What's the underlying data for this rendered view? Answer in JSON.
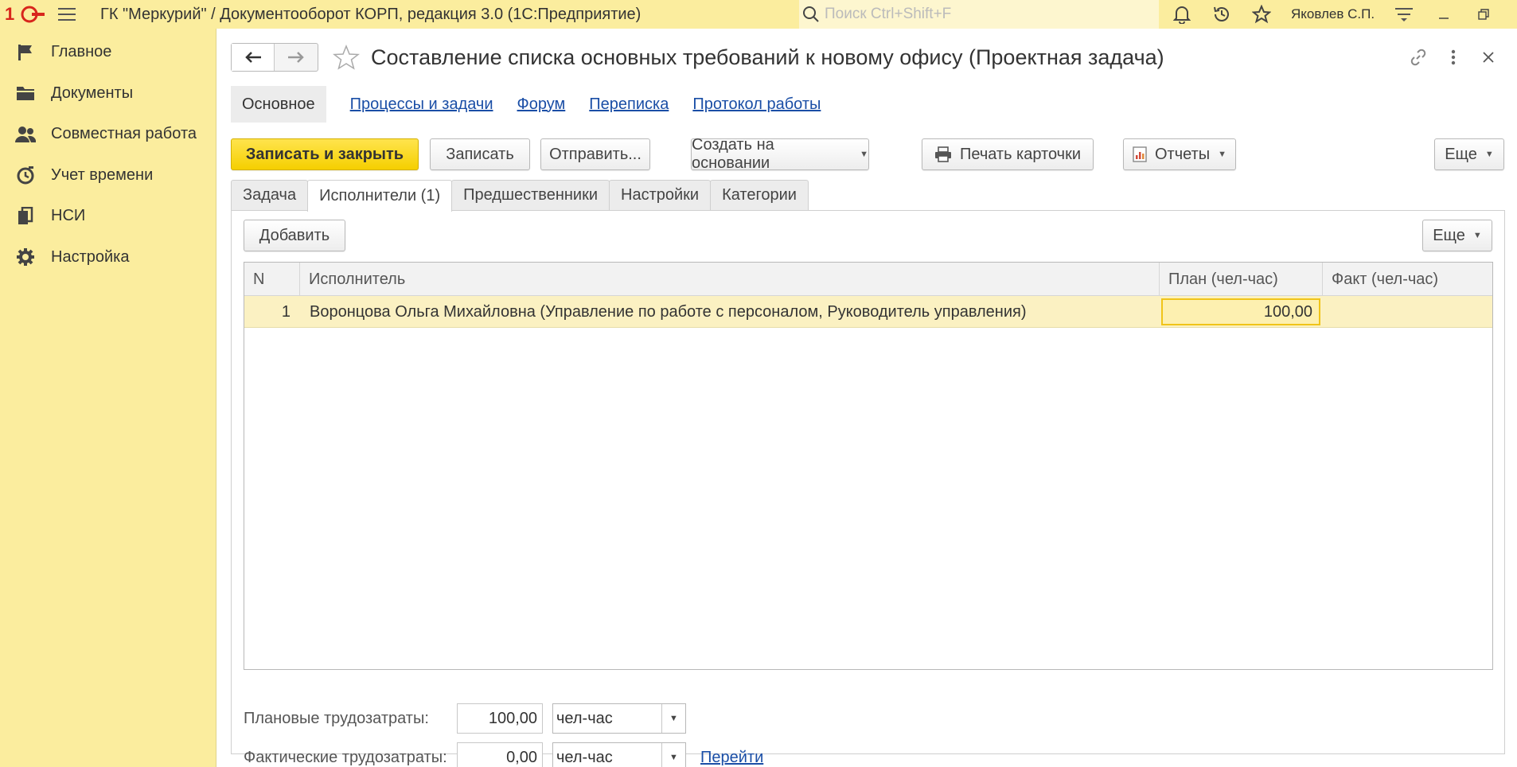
{
  "app": {
    "title": "ГК \"Меркурий\" / Документооборот КОРП, редакция 3.0  (1С:Предприятие)",
    "search_placeholder": "Поиск Ctrl+Shift+F",
    "user": "Яковлев С.П."
  },
  "sidebar": {
    "items": [
      {
        "label": "Главное",
        "icon": "flag-icon"
      },
      {
        "label": "Документы",
        "icon": "folder-icon"
      },
      {
        "label": "Совместная работа",
        "icon": "people-icon"
      },
      {
        "label": "Учет времени",
        "icon": "clock-icon"
      },
      {
        "label": "НСИ",
        "icon": "books-icon"
      },
      {
        "label": "Настройка",
        "icon": "gear-icon"
      }
    ]
  },
  "form": {
    "title": "Составление списка основных требований к новому офису (Проектная задача)",
    "sections": {
      "active": "Основное",
      "links": [
        "Процессы и задачи",
        "Форум",
        "Переписка",
        "Протокол работы"
      ]
    },
    "toolbar": {
      "save_close": "Записать и закрыть",
      "save": "Записать",
      "send": "Отправить...",
      "create_based": "Создать на основании",
      "print_card": "Печать карточки",
      "reports": "Отчеты",
      "more": "Еще"
    },
    "tabs": [
      "Задача",
      "Исполнители (1)",
      "Предшественники",
      "Настройки",
      "Категории"
    ],
    "active_tab": "Исполнители (1)",
    "executors": {
      "add": "Добавить",
      "more": "Еще",
      "columns": [
        "N",
        "Исполнитель",
        "План (чел-час)",
        "Факт (чел-час)"
      ],
      "rows": [
        {
          "n": "1",
          "executor": "Воронцова Ольга Михайловна (Управление по работе с персоналом, Руководитель управления)",
          "plan": "100,00",
          "fact": ""
        }
      ]
    },
    "labor": {
      "planned_label": "Плановые трудозатраты:",
      "planned_value": "100,00",
      "planned_unit": "чел-час",
      "actual_label": "Фактические трудозатраты:",
      "actual_value": "0,00",
      "actual_unit": "чел-час",
      "go_link": "Перейти"
    }
  },
  "colors": {
    "accent": "#fbed9e",
    "primary_button": "#f5cf00",
    "link": "#1a4ea6",
    "selected_row": "#fbf1c2"
  }
}
